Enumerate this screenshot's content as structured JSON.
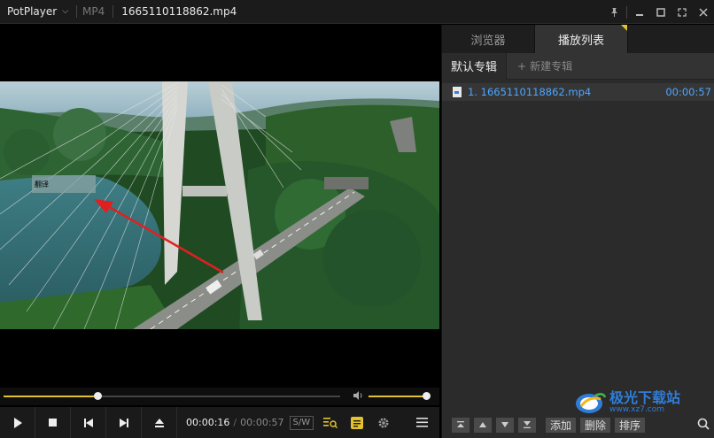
{
  "titlebar": {
    "app_name": "PotPlayer",
    "format": "MP4",
    "filename": "1665110118862.mp4"
  },
  "video": {
    "caption_text": "翻译"
  },
  "seek": {
    "progress": 0.28,
    "volume": 0.98
  },
  "controls": {
    "current_time": "00:00:16",
    "separator": "/",
    "duration": "00:00:57",
    "sw_badge": "S/W"
  },
  "panel": {
    "tabs": [
      "浏览器",
      "播放列表"
    ],
    "active_tab": 1,
    "default_album": "默认专辑",
    "new_album": "新建专辑",
    "new_album_prefix": "+",
    "playlist": [
      {
        "label": "1. 1665110118862.mp4",
        "duration": "00:00:57"
      }
    ],
    "bottom_buttons": [
      "添加",
      "删除",
      "排序"
    ]
  },
  "watermark": {
    "title": "极光下载站",
    "url": "www.xz7.com"
  },
  "colors": {
    "accent": "#e3c22f",
    "link": "#4da6ff",
    "arrow": "#e02020"
  },
  "icons": [
    "pin-icon",
    "minimize-icon",
    "maximize-icon",
    "fullscreen-icon",
    "close-icon",
    "play-icon",
    "stop-icon",
    "previous-icon",
    "next-icon",
    "eject-icon",
    "playlist-search-icon",
    "subtitle-icon",
    "settings-icon",
    "menu-icon",
    "search-icon",
    "volume-icon"
  ]
}
